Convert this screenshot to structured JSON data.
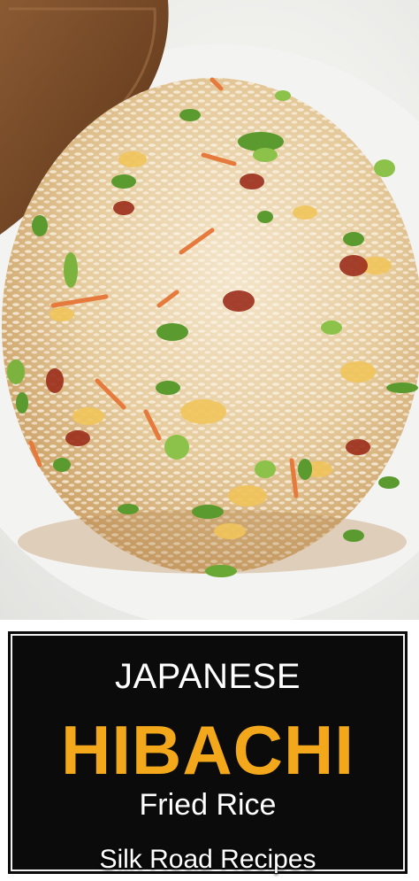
{
  "photo": {
    "subject": "fried-rice-dome-photo"
  },
  "banner": {
    "line1": "JAPANESE",
    "line2": "HIBACHI",
    "line3": "Fried Rice",
    "brand": "Silk Road Recipes"
  },
  "colors": {
    "panel_bg": "#0b0b0b",
    "accent": "#f2a81a",
    "text": "#ffffff"
  }
}
